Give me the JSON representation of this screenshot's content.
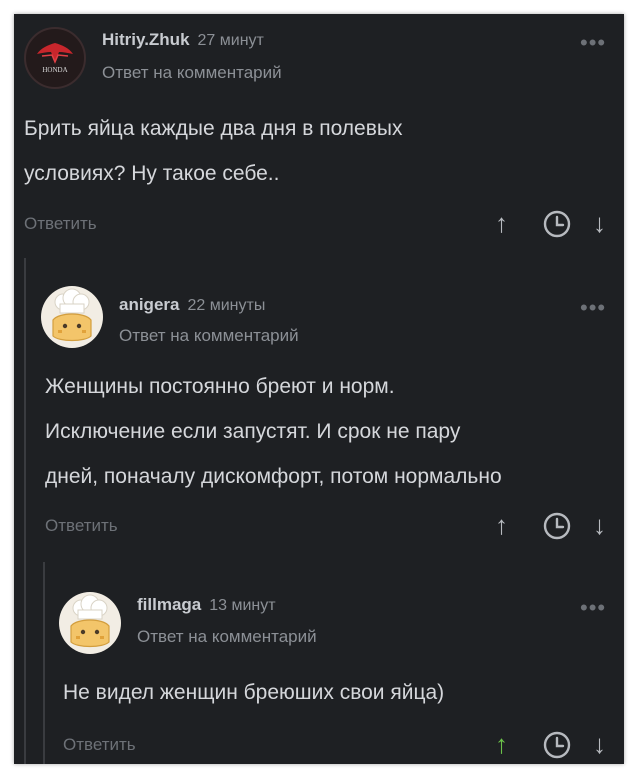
{
  "comments": [
    {
      "author": "Hitriy.Zhuk",
      "time": "27 минут",
      "reply_label": "Ответ на комментарий",
      "text_lines": [
        "Брить яйца каждые два дня в полевых",
        "условиях? Ну такое себе.."
      ],
      "reply_button": "Ответить",
      "avatar_icon": "honda-logo-icon",
      "avatar_text": "HONDA"
    },
    {
      "author": "anigera",
      "time": "22 минуты",
      "reply_label": "Ответ на комментарий",
      "text_lines": [
        "Женщины постоянно бреют и норм.",
        "Исключение если запустят. И срок не пару",
        "дней, поначалу дискомфорт, потом нормально"
      ],
      "reply_button": "Ответить",
      "avatar_icon": "chef-avatar-icon"
    },
    {
      "author": "fillmaga",
      "time": "13 минут",
      "reply_label": "Ответ на комментарий",
      "text_lines": [
        "Не видел женщин бреюших свои яйца)"
      ],
      "reply_button": "Ответить",
      "avatar_icon": "chef-avatar-icon"
    }
  ],
  "icons": {
    "more": "more-dots-icon",
    "upvote": "arrow-up-icon",
    "save": "clock-icon",
    "downvote": "arrow-down-icon"
  },
  "glyphs": {
    "dots": "•••",
    "up": "↑",
    "down": "↓"
  },
  "colors": {
    "background": "#1e2023",
    "text": "#d5d7db",
    "muted": "#8c9096",
    "upvoted": "#6cc24a"
  }
}
